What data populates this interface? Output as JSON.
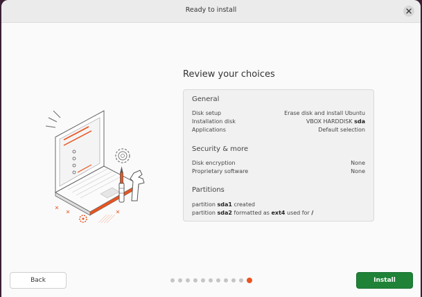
{
  "window": {
    "title": "Ready to install"
  },
  "review": {
    "heading": "Review your choices",
    "general": {
      "title": "General",
      "rows": [
        {
          "key": "Disk setup",
          "value": "Erase disk and install Ubuntu"
        },
        {
          "key": "Installation disk",
          "value_prefix": "VBOX HARDDISK ",
          "value_bold": "sda"
        },
        {
          "key": "Applications",
          "value": "Default selection"
        }
      ]
    },
    "security": {
      "title": "Security & more",
      "rows": [
        {
          "key": "Disk encryption",
          "value": "None"
        },
        {
          "key": "Proprietary software",
          "value": "None"
        }
      ]
    },
    "partitions": {
      "title": "Partitions",
      "line1": {
        "t1": "partition ",
        "b1": "sda1",
        "t2": " created"
      },
      "line2": {
        "t1": "partition ",
        "b1": "sda2",
        "t2": " formatted as ",
        "b2": "ext4",
        "t3": " used for ",
        "b3": "/"
      }
    }
  },
  "footer": {
    "back_label": "Back",
    "install_label": "Install",
    "progress": {
      "total_steps": 11,
      "current_step": 11
    }
  },
  "colors": {
    "accent": "#e95420",
    "install": "#1f8237"
  },
  "icons": {
    "close": "close-icon",
    "illustration": "laptop-tools-illustration"
  }
}
